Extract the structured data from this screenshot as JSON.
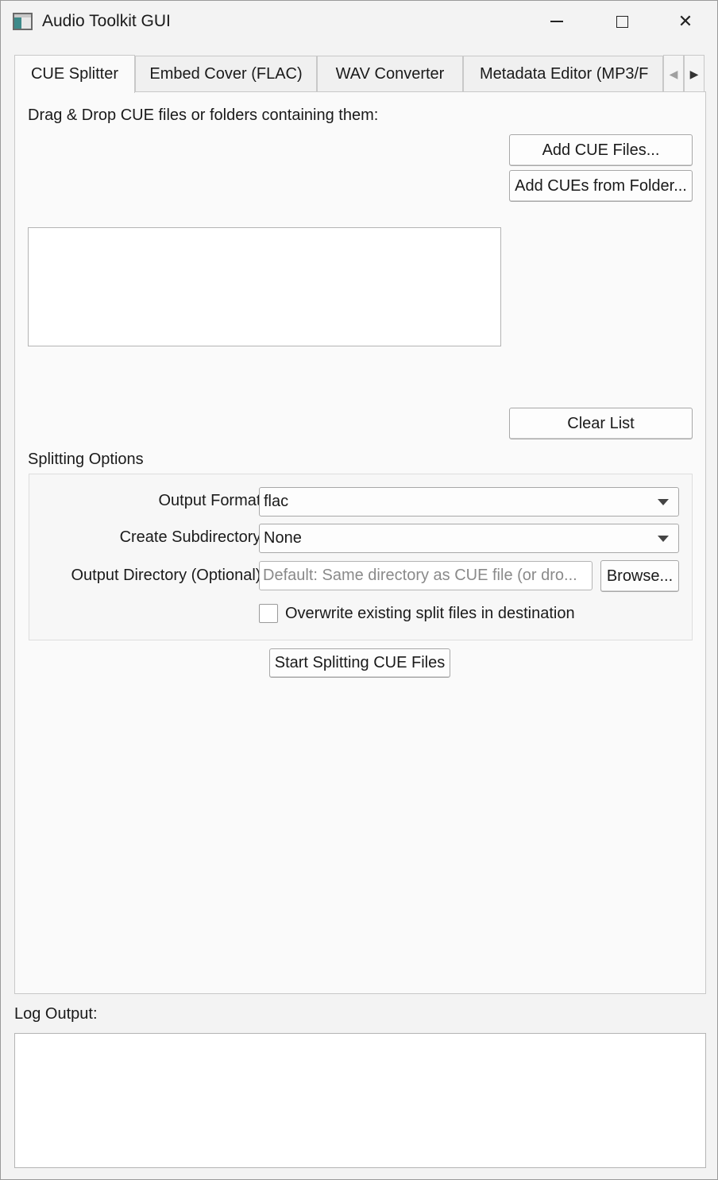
{
  "window": {
    "title": "Audio Toolkit GUI",
    "minimize_symbol": "",
    "close_symbol": "✕"
  },
  "tabs": [
    {
      "label": "CUE Splitter",
      "active": true
    },
    {
      "label": "Embed Cover (FLAC)",
      "active": false
    },
    {
      "label": "WAV Converter",
      "active": false
    },
    {
      "label": "Metadata Editor (MP3/F",
      "active": false
    }
  ],
  "tab_scroll": {
    "left": "◀",
    "right": "▶"
  },
  "cue_splitter": {
    "drop_label": "Drag & Drop CUE files or folders containing them:",
    "add_files_button": "Add CUE Files...",
    "add_folder_button": "Add CUEs from Folder...",
    "clear_list_button": "Clear List",
    "options_title": "Splitting Options",
    "output_format_label": "Output Format:",
    "output_format_value": "flac",
    "subdirectory_label": "Create Subdirectory:",
    "subdirectory_value": "None",
    "output_dir_label": "Output Directory (Optional):",
    "output_dir_placeholder": "Default: Same directory as CUE file (or dro...",
    "browse_button": "Browse...",
    "overwrite_label": "Overwrite existing split files in destination",
    "overwrite_checked": false,
    "start_button": "Start Splitting CUE Files"
  },
  "log": {
    "label": "Log Output:"
  }
}
